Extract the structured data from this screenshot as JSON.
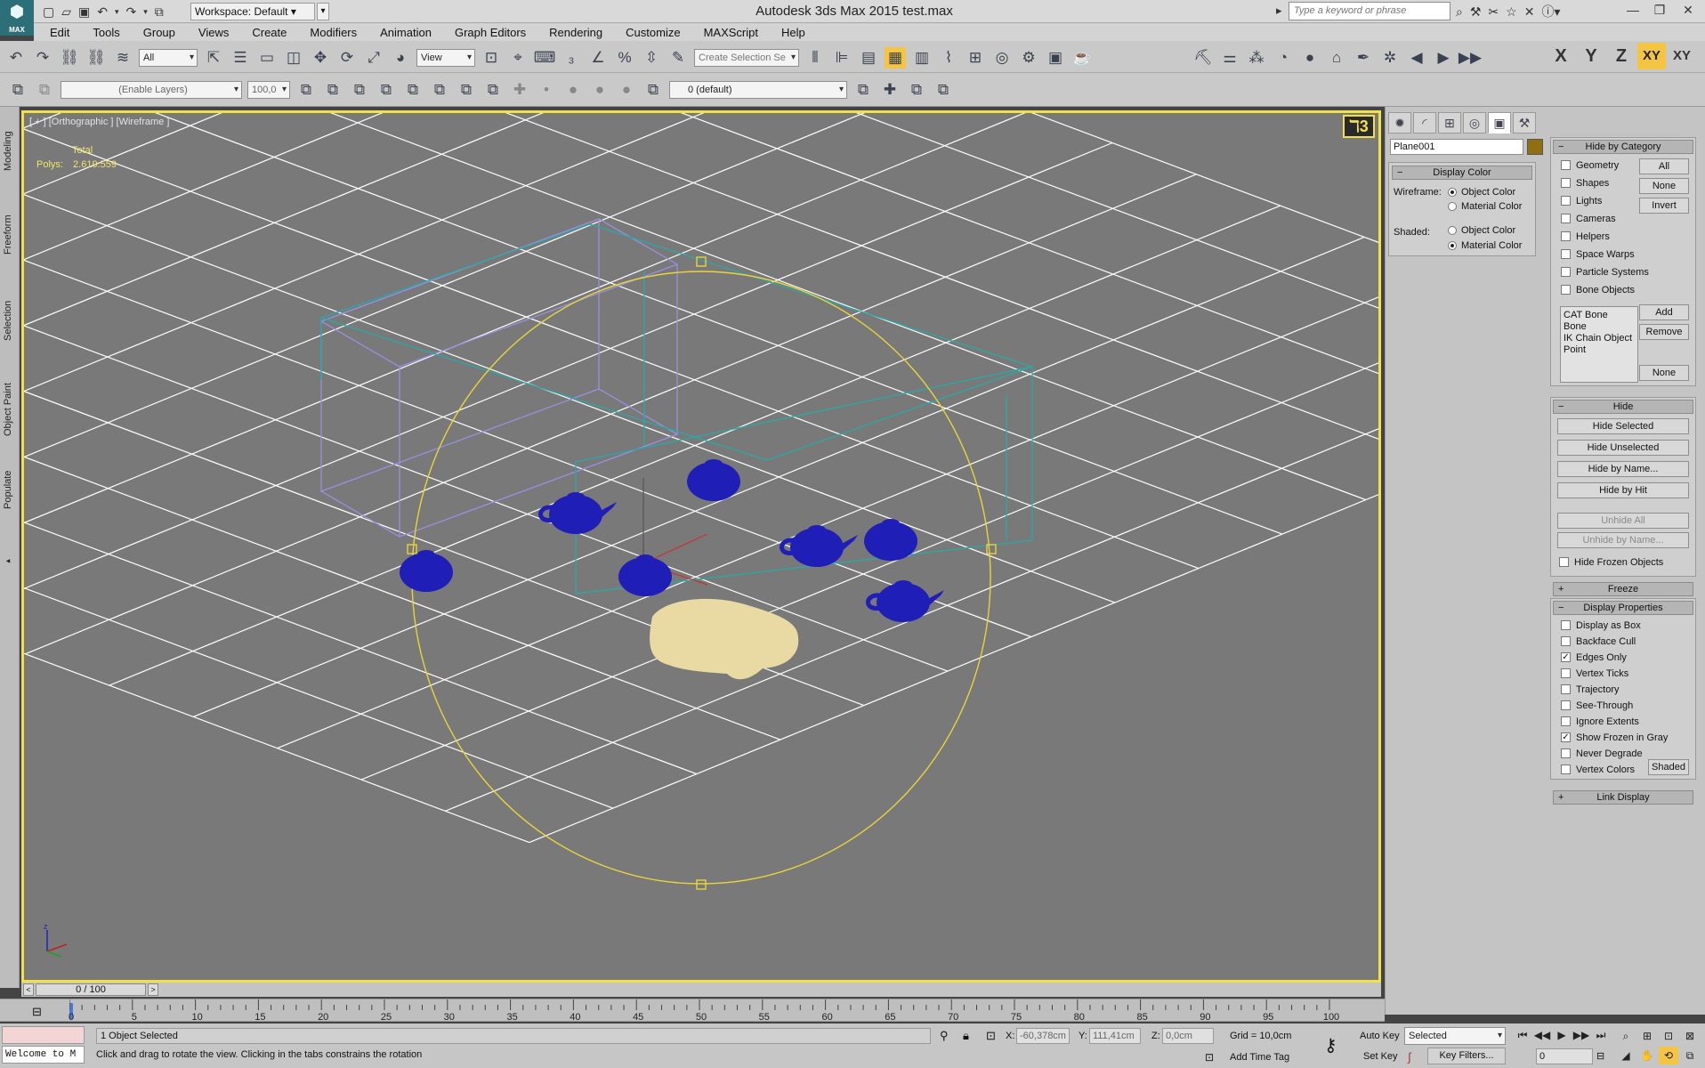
{
  "app": {
    "logo_text": "MAX",
    "workspace": "Workspace: Default",
    "title": "Autodesk 3ds Max  2015      test.max",
    "search_placeholder": "Type a keyword or phrase"
  },
  "menu": [
    "Edit",
    "Tools",
    "Group",
    "Views",
    "Create",
    "Modifiers",
    "Animation",
    "Graph Editors",
    "Rendering",
    "Customize",
    "MAXScript",
    "Help"
  ],
  "toolbar1": {
    "filter": "All",
    "ref_coord": "View",
    "selection_set_placeholder": "Create Selection Se",
    "axes": {
      "x": "X",
      "y": "Y",
      "z": "Z",
      "xy": "XY",
      "xy2": "XY"
    }
  },
  "toolbar2": {
    "layers_placeholder": "(Enable Layers)",
    "layer_value": "100,0",
    "current_layer": "0 (default)"
  },
  "ribbon": {
    "tabs": [
      "Modeling",
      "Freeform",
      "Selection",
      "Object Paint",
      "Populate"
    ]
  },
  "viewport": {
    "label": "[ + ] [Orthographic ] [Wireframe ]",
    "stats_total": "Total",
    "stats_polys_label": "Polys:",
    "stats_polys_value": "2.619.559",
    "nav_glyph": "ℸ3",
    "colors": {
      "grid": "#ffffff",
      "sphere": "#e8d43a",
      "teapot": "#1f1fb8",
      "car": "#e9d9a3",
      "box1": "#9a8fe0",
      "box2": "#2aa8a8"
    }
  },
  "cmdpanel": {
    "object_name": "Plane001",
    "display_color": {
      "title": "Display Color",
      "wireframe_label": "Wireframe:",
      "shaded_label": "Shaded:",
      "object_color": "Object Color",
      "material_color": "Material Color"
    },
    "hide_by_category": {
      "title": "Hide by Category",
      "items": [
        "Geometry",
        "Shapes",
        "Lights",
        "Cameras",
        "Helpers",
        "Space Warps",
        "Particle Systems",
        "Bone Objects"
      ],
      "btn_all": "All",
      "btn_none": "None",
      "btn_invert": "Invert",
      "list": [
        "CAT Bone",
        "Bone",
        "IK Chain Object",
        "Point"
      ],
      "btn_add": "Add",
      "btn_remove": "Remove",
      "btn_none2": "None"
    },
    "hide": {
      "title": "Hide",
      "buttons": [
        "Hide Selected",
        "Hide Unselected",
        "Hide by Name...",
        "Hide by Hit"
      ],
      "disabled": [
        "Unhide All",
        "Unhide by Name..."
      ],
      "frozen": "Hide Frozen Objects"
    },
    "freeze": {
      "title": "Freeze"
    },
    "display_properties": {
      "title": "Display Properties",
      "items": [
        "Display as Box",
        "Backface Cull",
        "Edges Only",
        "Vertex Ticks",
        "Trajectory",
        "See-Through",
        "Ignore Extents",
        "Show Frozen in Gray",
        "Never Degrade",
        "Vertex Colors"
      ],
      "checked": [
        false,
        false,
        true,
        false,
        false,
        false,
        false,
        true,
        false,
        false
      ],
      "shaded_btn": "Shaded"
    },
    "link_display": {
      "title": "Link Display"
    }
  },
  "timeline": {
    "frame": "0 / 100",
    "ticks": [
      "0",
      "5",
      "10",
      "15",
      "20",
      "25",
      "30",
      "35",
      "40",
      "45",
      "50",
      "55",
      "60",
      "65",
      "70",
      "75",
      "80",
      "85",
      "90",
      "95",
      "100"
    ]
  },
  "status": {
    "welcome": "Welcome to M",
    "selected": "1 Object Selected",
    "prompt": "Click and drag to rotate the view.  Clicking in the tabs constrains the rotation",
    "x_label": "X:",
    "x_value": "-60,378cm",
    "y_label": "Y:",
    "y_value": "111,41cm",
    "z_label": "Z:",
    "z_value": "0,0cm",
    "grid": "Grid = 10,0cm",
    "add_time_tag": "Add Time Tag",
    "auto_key": "Auto Key",
    "set_key": "Set Key",
    "key_mode": "Selected",
    "key_filters": "Key Filters...",
    "frame_field": "0"
  }
}
